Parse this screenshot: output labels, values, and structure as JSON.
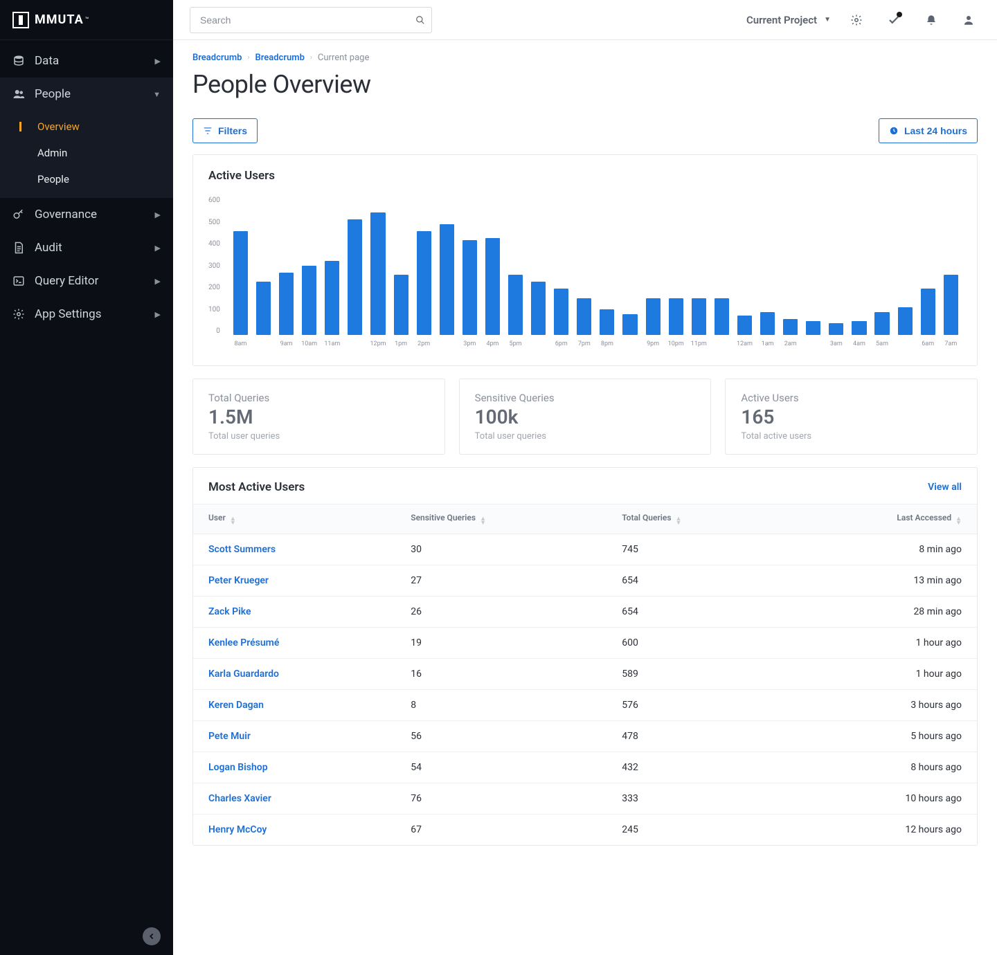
{
  "logo": "MMUTA",
  "search": {
    "placeholder": "Search"
  },
  "topbar": {
    "project_label": "Current Project"
  },
  "sidebar": {
    "items": [
      {
        "label": "Data"
      },
      {
        "label": "People"
      },
      {
        "label": "Governance"
      },
      {
        "label": "Audit"
      },
      {
        "label": "Query Editor"
      },
      {
        "label": "App Settings"
      }
    ],
    "people_sub": [
      {
        "label": "Overview"
      },
      {
        "label": "Admin"
      },
      {
        "label": "People"
      }
    ]
  },
  "breadcrumb": {
    "a": "Breadcrumb",
    "b": "Breadcrumb",
    "current": "Current page"
  },
  "page_title": "People Overview",
  "toolbar": {
    "filters": "Filters",
    "range": "Last 24 hours"
  },
  "chart_data": {
    "type": "bar",
    "title": "Active Users",
    "ylabel": "",
    "xlabel": "",
    "ylim": [
      0,
      600
    ],
    "yticks": [
      600,
      500,
      400,
      300,
      200,
      100,
      0
    ],
    "categories": [
      "8am",
      "9am",
      "10am",
      "11am",
      "12pm",
      "1pm",
      "2pm",
      "3pm",
      "4pm",
      "5pm",
      "6pm",
      "7pm",
      "8pm",
      "9pm",
      "10pm",
      "11pm",
      "12am",
      "1am",
      "2am",
      "3am",
      "4am",
      "5am",
      "6am",
      "7am"
    ],
    "values": [
      450,
      230,
      270,
      300,
      320,
      500,
      530,
      260,
      450,
      480,
      410,
      420,
      260,
      230,
      200,
      160,
      110,
      90,
      160,
      160,
      160,
      160,
      85,
      100,
      70,
      60,
      50,
      60,
      100,
      120,
      200,
      260
    ]
  },
  "stats": [
    {
      "label": "Total Queries",
      "value": "1.5M",
      "sub": "Total user queries"
    },
    {
      "label": "Sensitive Queries",
      "value": "100k",
      "sub": "Total user queries"
    },
    {
      "label": "Active Users",
      "value": "165",
      "sub": "Total active users"
    }
  ],
  "table": {
    "title": "Most Active Users",
    "view_all": "View all",
    "columns": {
      "user": "User",
      "sensitive": "Sensitive Queries",
      "total": "Total Queries",
      "last": "Last Accessed"
    },
    "rows": [
      {
        "user": "Scott Summers",
        "sensitive": "30",
        "total": "745",
        "last": "8 min ago"
      },
      {
        "user": "Peter Krueger",
        "sensitive": "27",
        "total": "654",
        "last": "13 min ago"
      },
      {
        "user": "Zack Pike",
        "sensitive": "26",
        "total": "654",
        "last": "28 min ago"
      },
      {
        "user": "Kenlee Présumé",
        "sensitive": "19",
        "total": "600",
        "last": "1 hour ago"
      },
      {
        "user": "Karla Guardardo",
        "sensitive": "16",
        "total": "589",
        "last": "1 hour ago"
      },
      {
        "user": "Keren Dagan",
        "sensitive": "8",
        "total": "576",
        "last": "3 hours ago"
      },
      {
        "user": "Pete Muir",
        "sensitive": "56",
        "total": "478",
        "last": "5 hours ago"
      },
      {
        "user": "Logan Bishop",
        "sensitive": "54",
        "total": "432",
        "last": "8 hours ago"
      },
      {
        "user": "Charles Xavier",
        "sensitive": "76",
        "total": "333",
        "last": "10 hours ago"
      },
      {
        "user": "Henry McCoy",
        "sensitive": "67",
        "total": "245",
        "last": "12 hours ago"
      }
    ]
  }
}
